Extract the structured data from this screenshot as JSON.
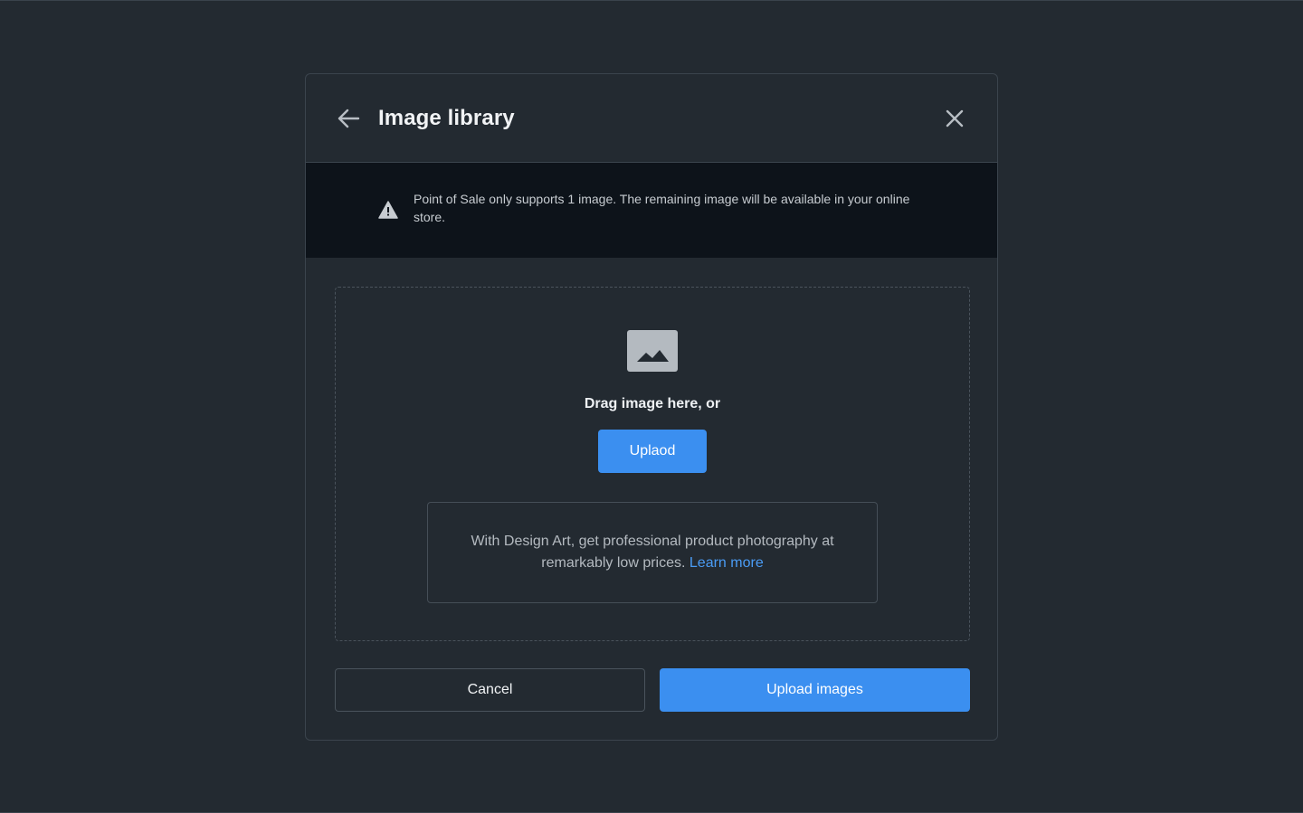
{
  "modal": {
    "title": "Image library",
    "back_icon": "arrow-left-icon",
    "close_icon": "close-icon"
  },
  "banner": {
    "icon": "warning-icon",
    "message": "Point of Sale only supports 1 image. The remaining image will be available in your online store."
  },
  "dropzone": {
    "icon": "image-placeholder-icon",
    "drag_text": "Drag image here, or",
    "upload_label": "Uplaod",
    "promo_text": "With Design Art, get professional product photography at remarkably low prices.",
    "promo_link": "Learn more"
  },
  "footer": {
    "cancel_label": "Cancel",
    "submit_label": "Upload images"
  },
  "colors": {
    "background": "#232a31",
    "banner": "#0d131a",
    "accent": "#3b8ff0",
    "link": "#4a9cf5"
  }
}
